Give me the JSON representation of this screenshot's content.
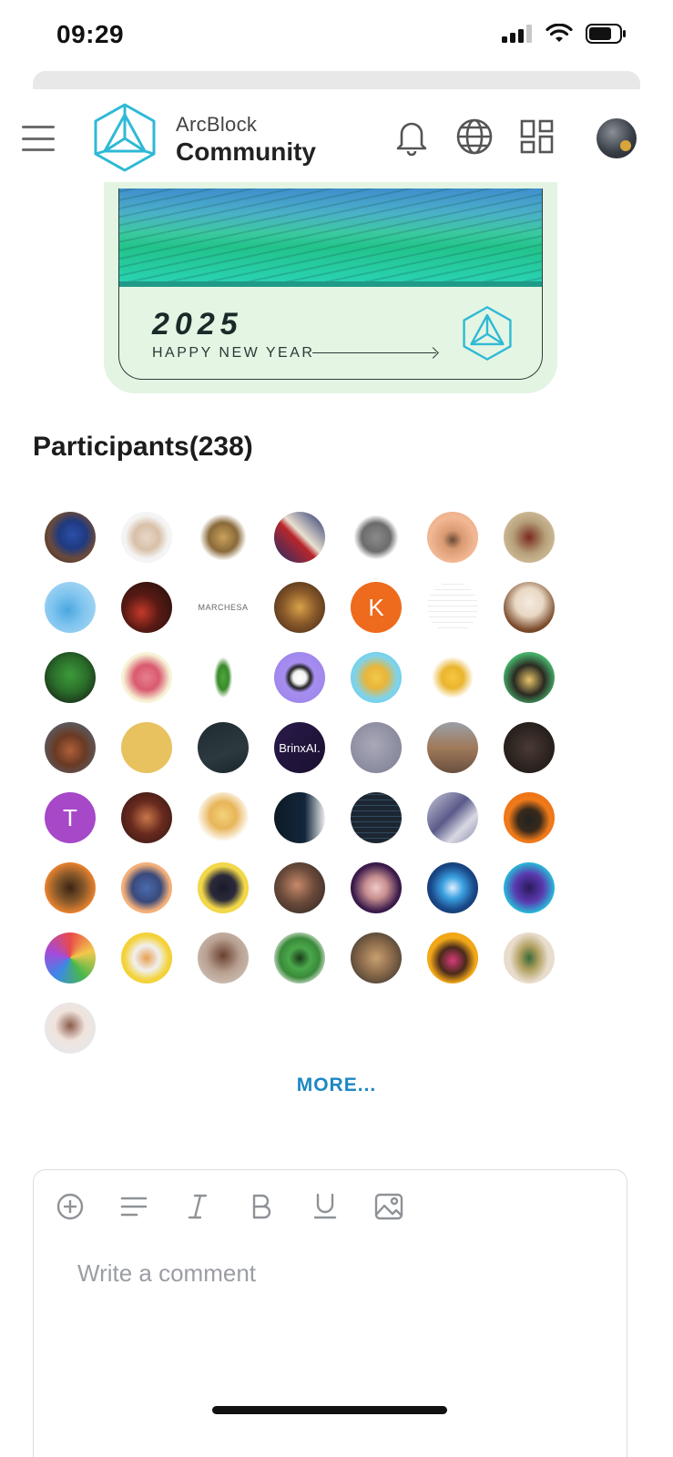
{
  "status_bar": {
    "time": "09:29"
  },
  "header": {
    "brand_top": "ArcBlock",
    "brand_bottom": "Community"
  },
  "banner": {
    "year": "2025",
    "greeting": "HAPPY NEW YEAR"
  },
  "participants": {
    "title": "Participants(238)",
    "avatar_labels": {
      "k": "K",
      "marchesa": "MARCHESA",
      "brinx": "BrinxAI.",
      "t": "T"
    },
    "more_label": "MORE..."
  },
  "comment": {
    "placeholder": "Write a comment",
    "toolbar": [
      "add-icon",
      "paragraph-icon",
      "italic-icon",
      "bold-icon",
      "underline-icon",
      "image-icon"
    ]
  },
  "colors": {
    "accent": "#1d87c4",
    "banner_bg": "#e3f4e3",
    "avatar_k": "#ee6a1c",
    "avatar_t": "#a648c8"
  }
}
